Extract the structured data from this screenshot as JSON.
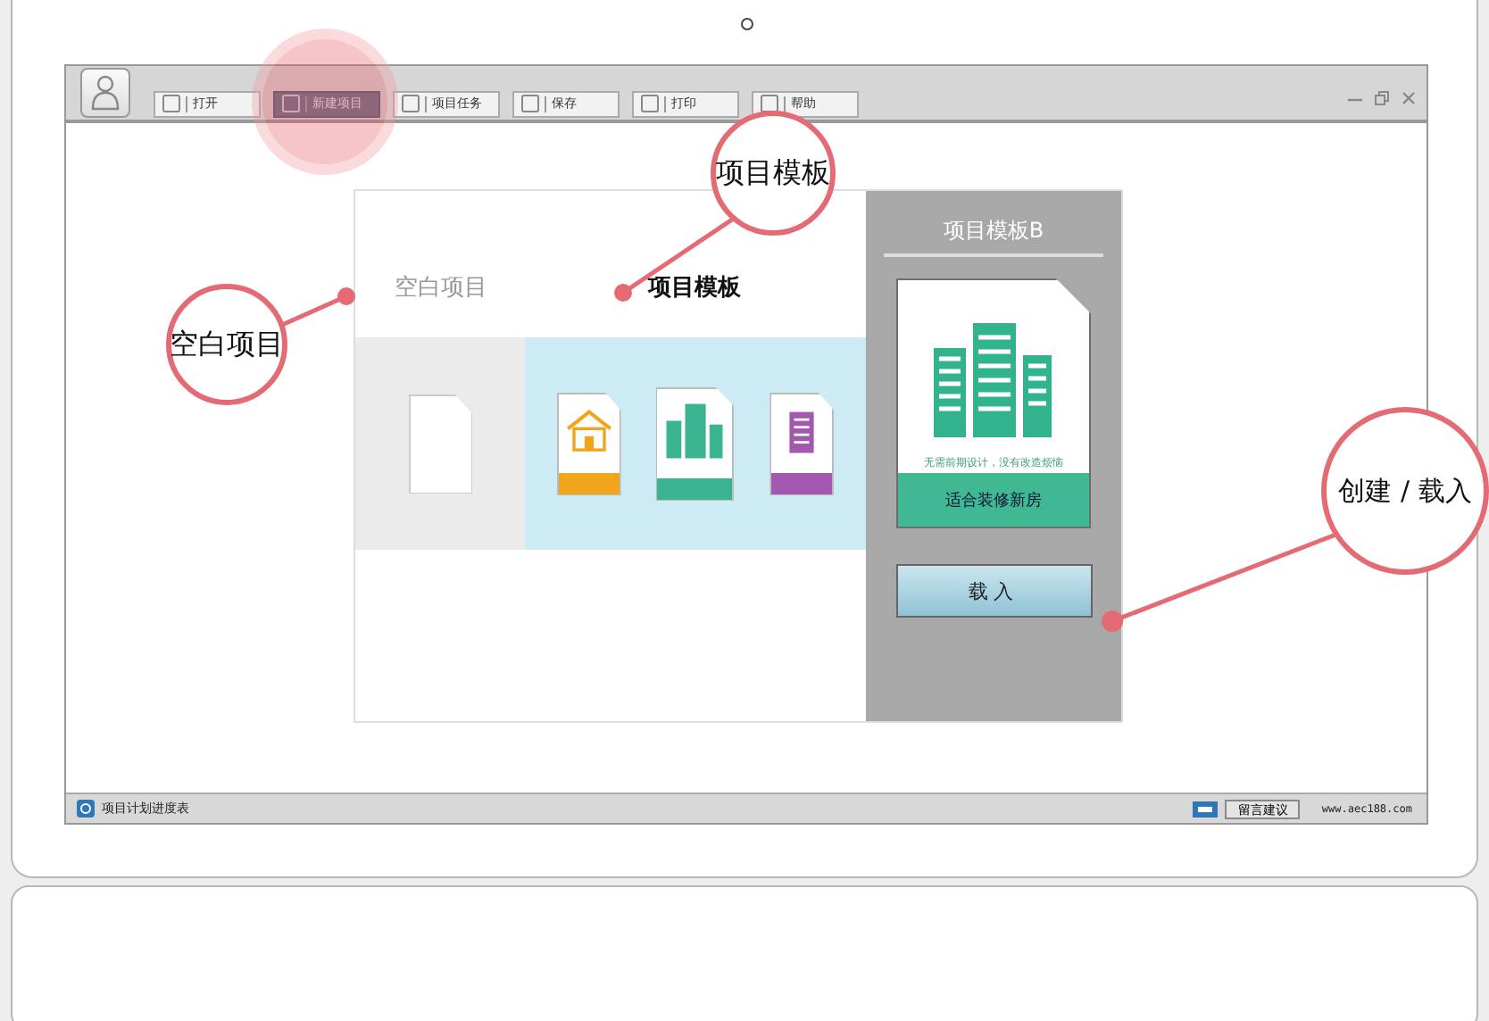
{
  "toolbar": {
    "buttons": [
      {
        "label": "打开",
        "selected": false
      },
      {
        "label": "新建项目",
        "selected": true
      },
      {
        "label": "项目任务",
        "selected": false
      },
      {
        "label": "保存",
        "selected": false
      },
      {
        "label": "打印",
        "selected": false
      },
      {
        "label": "帮助",
        "selected": false
      }
    ]
  },
  "dialog": {
    "tabs": [
      {
        "label": "空白项目",
        "selected": false
      },
      {
        "label": "项目模板",
        "selected": true
      }
    ],
    "templates": [
      {
        "kind": "house",
        "color": "#f0a51c",
        "selected": false
      },
      {
        "kind": "towers",
        "color": "#3bb58f",
        "selected": true
      },
      {
        "kind": "building",
        "color": "#a359b0",
        "selected": false
      }
    ],
    "preview": {
      "title": "项目模板B",
      "subtitle": "无需前期设计，没有改造烦恼",
      "caption": "适合装修新房",
      "load_button": "载入"
    }
  },
  "status_bar": {
    "app_name": "项目计划进度表",
    "feedback_button": "留言建议",
    "url": "www.aec188.com"
  },
  "annotations": [
    {
      "label": "空白项目"
    },
    {
      "label": "项目模板"
    },
    {
      "label": "创建 / 载入"
    }
  ]
}
